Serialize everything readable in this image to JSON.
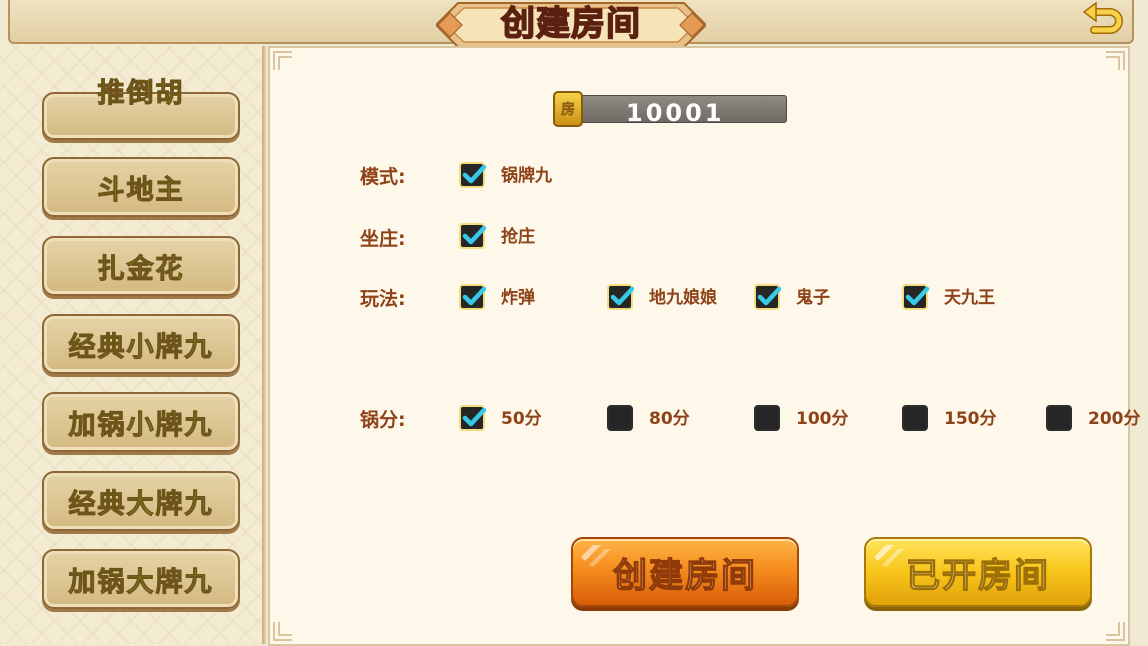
{
  "header": {
    "title": "创建房间",
    "back_icon": "back-arrow-icon"
  },
  "sidebar": {
    "items": [
      {
        "label": "推倒胡"
      },
      {
        "label": "斗地主"
      },
      {
        "label": "扎金花"
      },
      {
        "label": "经典小牌九"
      },
      {
        "label": "加锅小牌九"
      },
      {
        "label": "经典大牌九"
      },
      {
        "label": "加锅大牌九"
      }
    ]
  },
  "room": {
    "icon_text": "房",
    "number": "10001"
  },
  "settings": {
    "mode": {
      "label": "模式:",
      "options": [
        {
          "label": "锅牌九",
          "checked": true
        }
      ]
    },
    "banker": {
      "label": "坐庄:",
      "options": [
        {
          "label": "抢庄",
          "checked": true
        }
      ]
    },
    "play": {
      "label": "玩法:",
      "options": [
        {
          "label": "炸弹",
          "checked": true
        },
        {
          "label": "地九娘娘",
          "checked": true
        },
        {
          "label": "鬼子",
          "checked": true
        },
        {
          "label": "天九王",
          "checked": true
        }
      ]
    },
    "pot": {
      "label": "锅分:",
      "options": [
        {
          "label": "50分",
          "checked": true
        },
        {
          "label": "80分",
          "checked": false
        },
        {
          "label": "100分",
          "checked": false
        },
        {
          "label": "150分",
          "checked": false
        },
        {
          "label": "200分",
          "checked": false
        }
      ]
    }
  },
  "actions": {
    "create": "创建房间",
    "opened": "已开房间"
  },
  "colors": {
    "label_brown": "#8e4218",
    "accent_orange": "#f58d1e",
    "accent_yellow": "#f8c51a",
    "check_cyan": "#38c9e8"
  }
}
